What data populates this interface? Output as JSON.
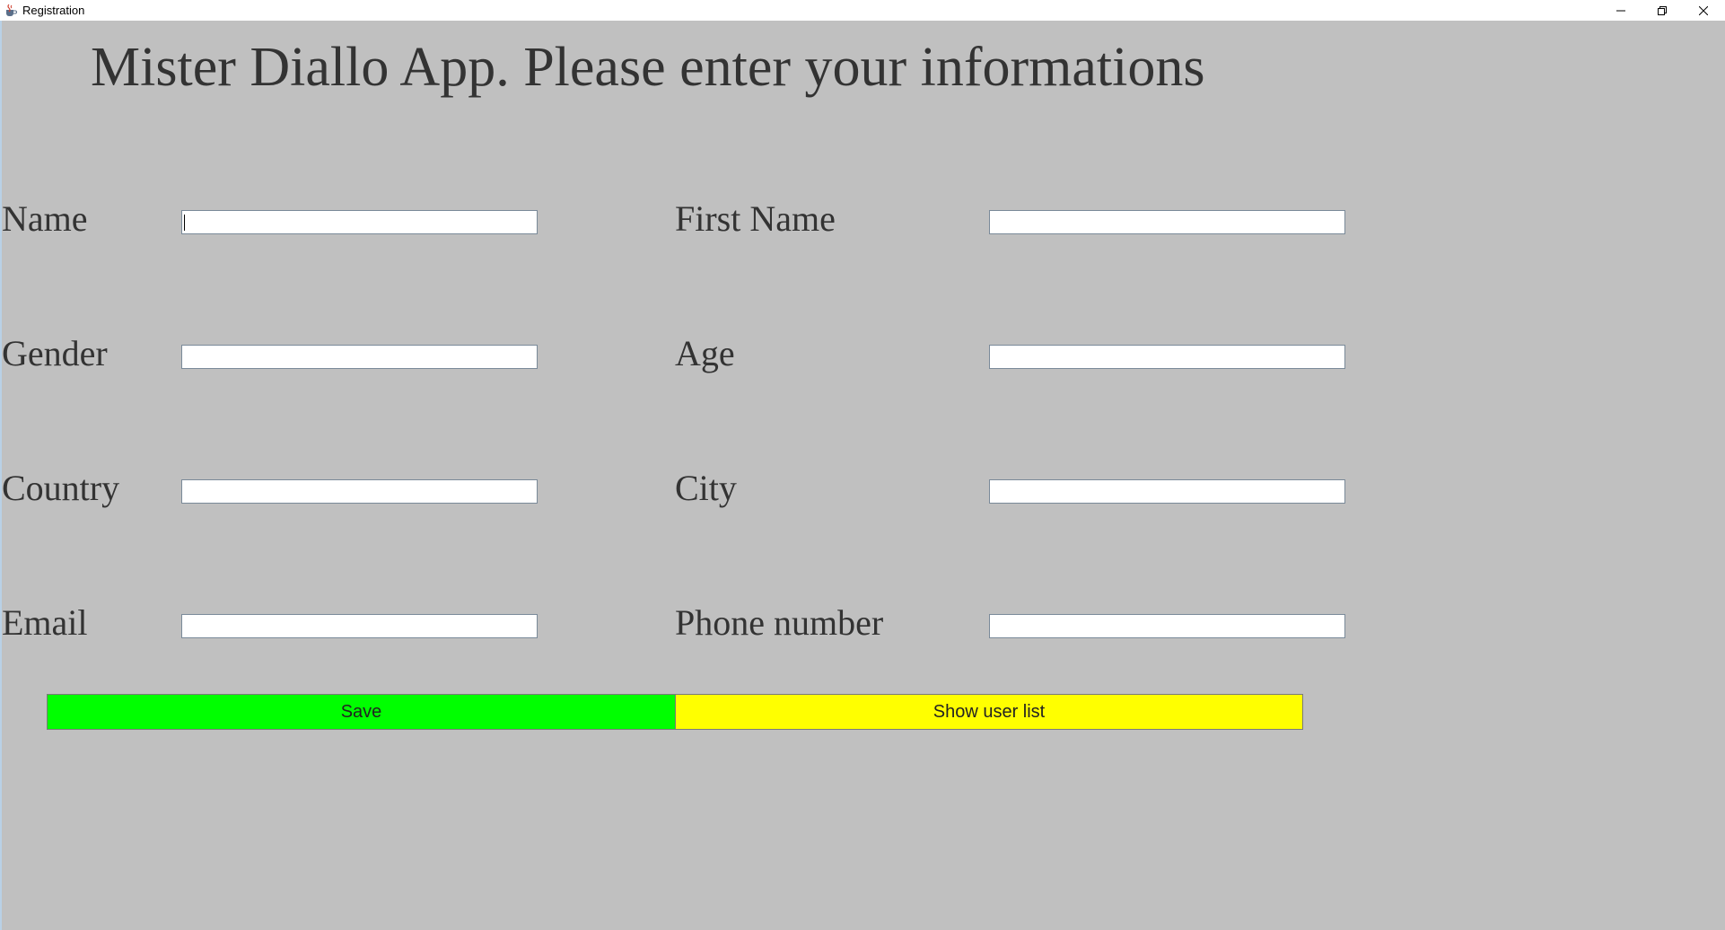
{
  "window": {
    "title": "Registration"
  },
  "heading": "Mister Diallo App. Please enter your informations",
  "form": {
    "name_label": "Name",
    "first_name_label": "First Name",
    "gender_label": "Gender",
    "age_label": "Age",
    "country_label": "Country",
    "city_label": "City",
    "email_label": "Email",
    "phone_label": "Phone number",
    "values": {
      "name": "",
      "first_name": "",
      "gender": "",
      "age": "",
      "country": "",
      "city": "",
      "email": "",
      "phone": ""
    }
  },
  "actions": {
    "save_label": "Save",
    "save_color": "#00ff00",
    "show_list_label": "Show user list",
    "show_list_color": "#ffff00"
  },
  "icons": {
    "app": "java-cup-icon",
    "minimize": "minimize-icon",
    "maximize": "restore-icon",
    "close": "close-icon"
  }
}
